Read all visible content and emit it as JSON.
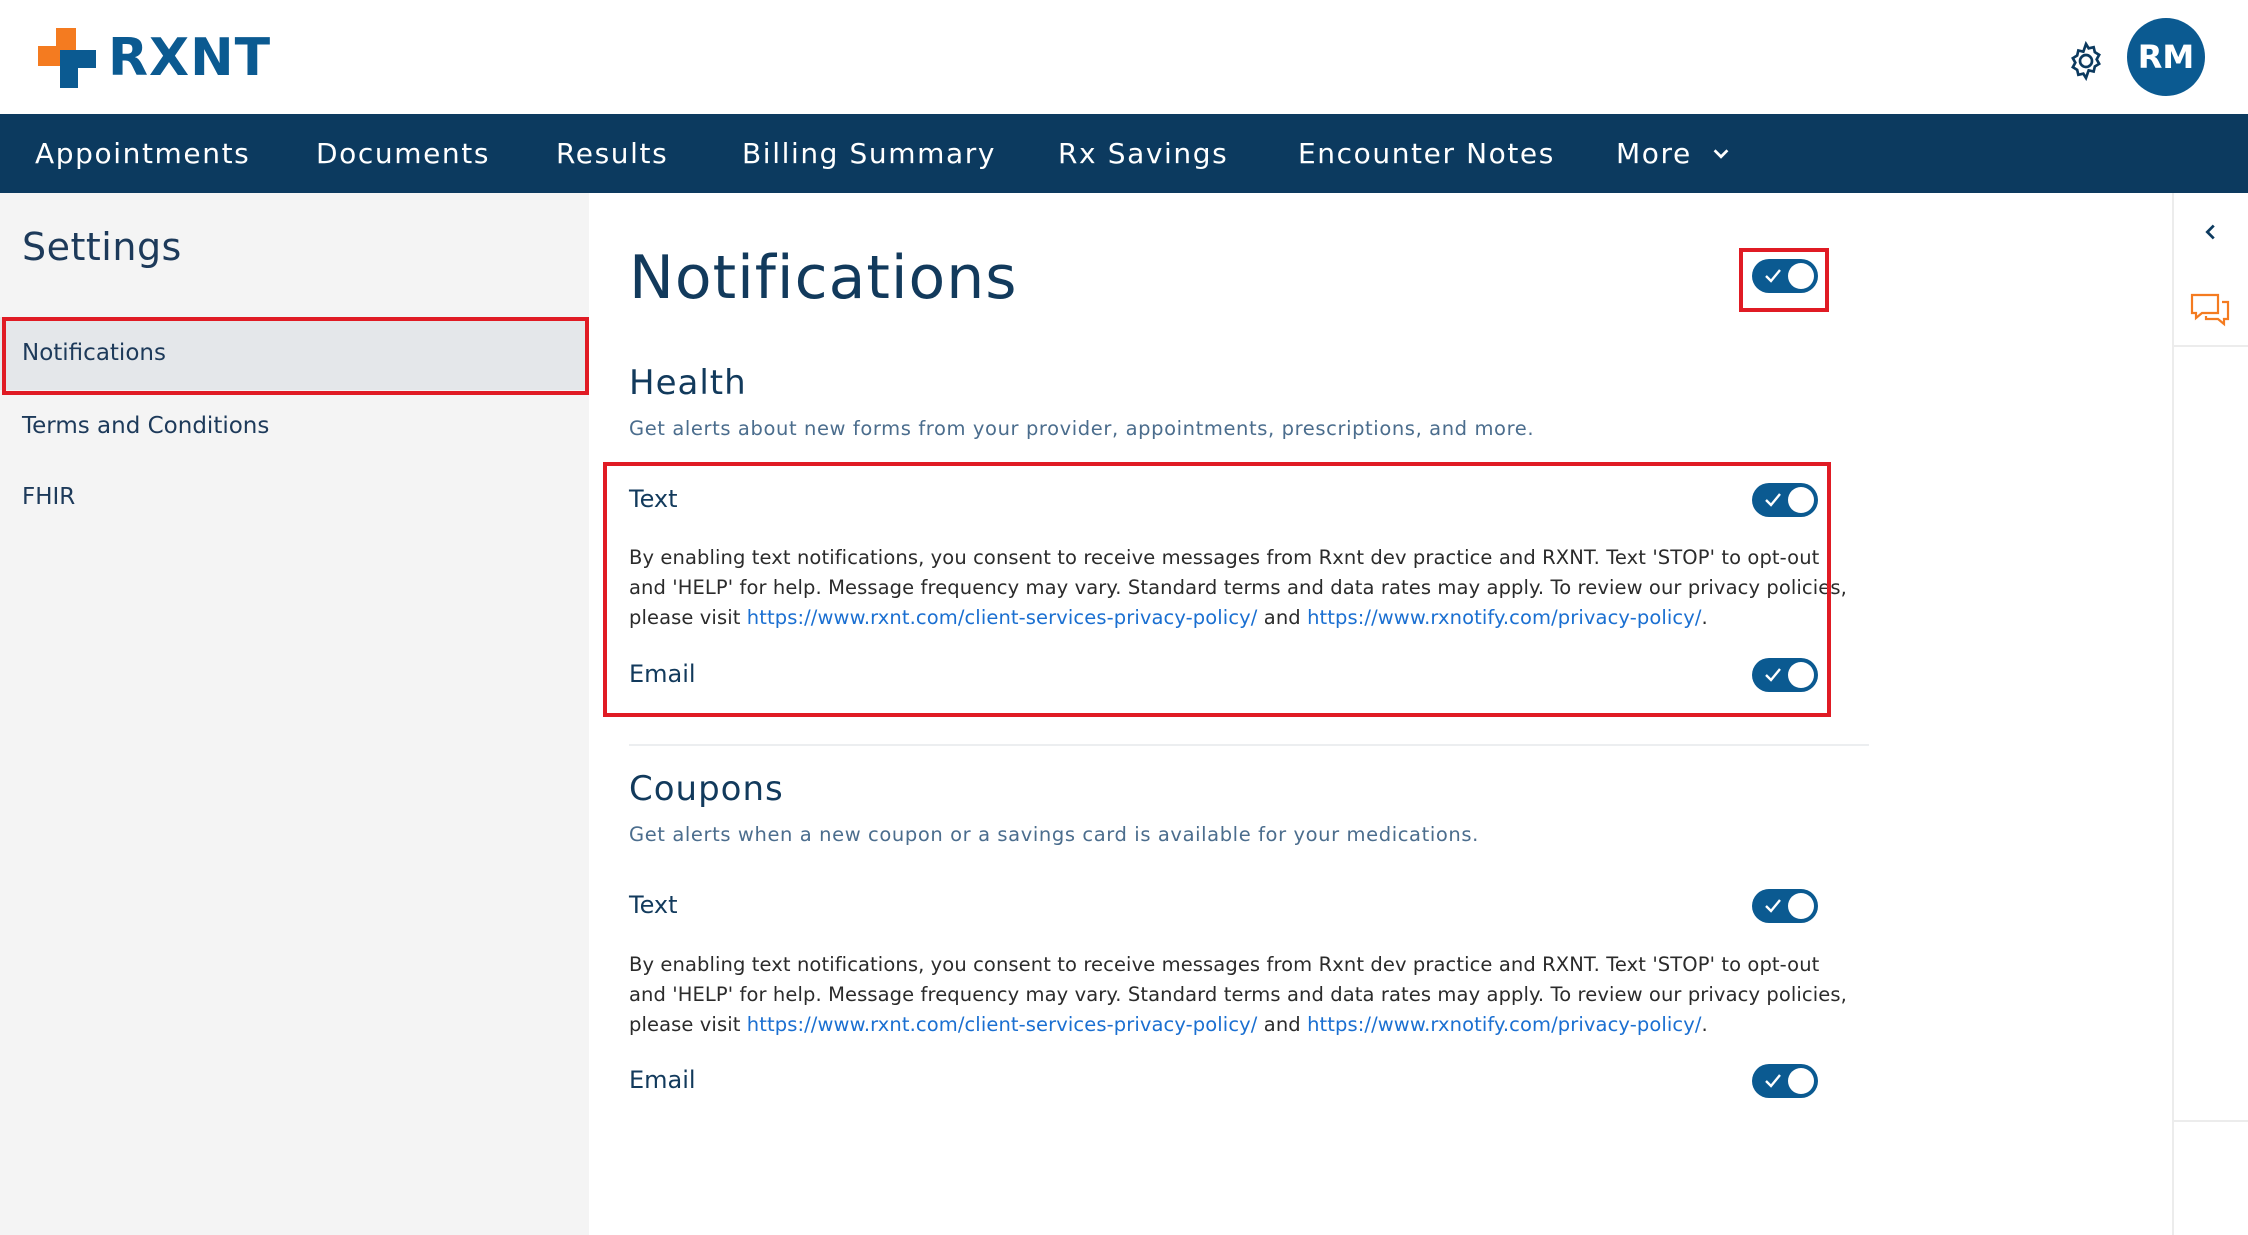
{
  "brand": {
    "name": "RXNT",
    "accent": "#0b5a91",
    "nav_bg": "#0c3a5f",
    "logo_orange": "#f47b20"
  },
  "header": {
    "avatar_initials": "RM",
    "settings_icon": "gear-icon"
  },
  "nav": {
    "items": [
      {
        "label": "Appointments"
      },
      {
        "label": "Documents"
      },
      {
        "label": "Results"
      },
      {
        "label": "Billing Summary"
      },
      {
        "label": "Rx Savings"
      },
      {
        "label": "Encounter Notes"
      },
      {
        "label": "More"
      }
    ]
  },
  "sidebar": {
    "title": "Settings",
    "items": [
      {
        "label": "Notifications",
        "active": true
      },
      {
        "label": "Terms and Conditions"
      },
      {
        "label": "FHIR"
      }
    ]
  },
  "main": {
    "title": "Notifications",
    "master_toggle_on": true,
    "sections": [
      {
        "title": "Health",
        "description": "Get alerts about new forms from your provider, appointments, prescriptions, and more.",
        "text_label": "Text",
        "text_on": true,
        "consent_line1": "By enabling text notifications, you consent to receive messages from Rxnt dev practice and RXNT. Text 'STOP' to opt-out",
        "consent_line2": "and 'HELP' for help. Message frequency may vary. Standard terms and data rates may apply. To review our privacy policies,",
        "consent_prefix": "please visit ",
        "link1": "https://www.rxnt.com/client-services-privacy-policy/",
        "consent_and": " and ",
        "link2": "https://www.rxnotify.com/privacy-policy/",
        "consent_end": ".",
        "email_label": "Email",
        "email_on": true
      },
      {
        "title": "Coupons",
        "description": "Get alerts when a new coupon or a savings card is available for your medications.",
        "text_label": "Text",
        "text_on": true,
        "consent_line1": "By enabling text notifications, you consent to receive messages from Rxnt dev practice and RXNT. Text 'STOP' to opt-out",
        "consent_line2": "and 'HELP' for help. Message frequency may vary. Standard terms and data rates may apply. To review our privacy policies,",
        "consent_prefix": "please visit ",
        "link1": "https://www.rxnt.com/client-services-privacy-policy/",
        "consent_and": " and ",
        "link2": "https://www.rxnotify.com/privacy-policy/",
        "consent_end": ".",
        "email_label": "Email",
        "email_on": true
      }
    ]
  }
}
